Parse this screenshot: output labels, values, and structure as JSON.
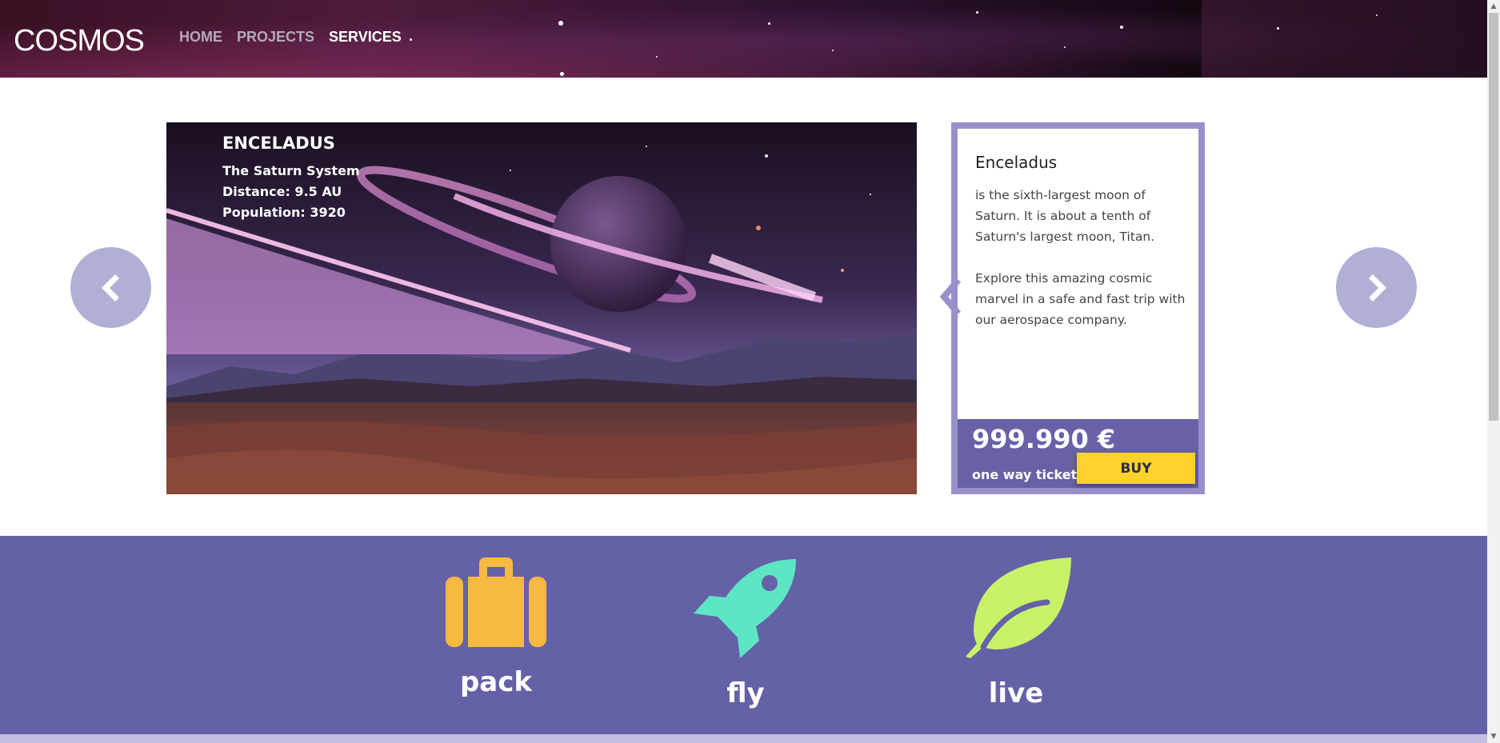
{
  "header": {
    "logo": "COSMOS",
    "nav": [
      {
        "label": "HOME",
        "active": false
      },
      {
        "label": "PROJECTS",
        "active": false
      },
      {
        "label": "SERVICES",
        "active": true
      }
    ]
  },
  "carousel": {
    "prev_icon": "chevron-left-icon",
    "next_icon": "chevron-right-icon"
  },
  "hero": {
    "title": "ENCELADUS",
    "system": "The Saturn System",
    "distance": "Distance: 9.5 AU",
    "population": "Population: 3920"
  },
  "card": {
    "title": "Enceladus",
    "description": "is the sixth-largest moon of Saturn. It is about a tenth of Saturn's largest moon, Titan.\n\nExplore this amazing cosmic marvel in a safe and fast trip with our aerospace company.",
    "price": "999.990 €",
    "ticket_label": "one way ticket",
    "buy_label": "BUY"
  },
  "features": [
    {
      "label": "pack",
      "icon": "suitcase-icon",
      "color": "#f7b941"
    },
    {
      "label": "fly",
      "icon": "rocket-icon",
      "color": "#5de6c4"
    },
    {
      "label": "live",
      "icon": "leaf-icon",
      "color": "#c7f267"
    }
  ],
  "colors": {
    "accent": "#6561a7",
    "card_border": "#9891c9",
    "arrow_bg": "#b2afd4",
    "buy_button": "#fdd32b"
  }
}
